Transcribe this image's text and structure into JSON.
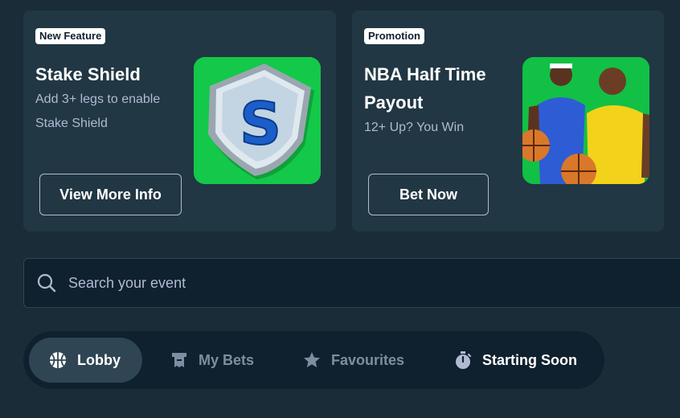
{
  "cards": [
    {
      "badge": "New Feature",
      "title": "Stake Shield",
      "subtitle": "Add 3+ legs to enable Stake Shield",
      "button": "View More Info",
      "image": "stake-shield-logo"
    },
    {
      "badge": "Promotion",
      "title": "NBA Half Time Payout",
      "subtitle": "12+ Up? You Win",
      "button": "Bet Now",
      "image": "basketball-players"
    }
  ],
  "search": {
    "placeholder": "Search your event",
    "icon": "search-icon"
  },
  "tabs": [
    {
      "label": "Lobby",
      "icon": "basketball-icon",
      "active": true
    },
    {
      "label": "My Bets",
      "icon": "bet-slip-icon",
      "active": false
    },
    {
      "label": "Favourites",
      "icon": "star-icon",
      "active": false
    },
    {
      "label": "Starting Soon",
      "icon": "stopwatch-icon",
      "active": false
    }
  ],
  "colors": {
    "background": "#1a2c38",
    "card": "#213743",
    "input": "#0f212e",
    "active_tab": "#2f4553",
    "muted_text": "#b1bad3",
    "dim_text": "#7d8ea0",
    "promo_green": "#14c84a"
  }
}
